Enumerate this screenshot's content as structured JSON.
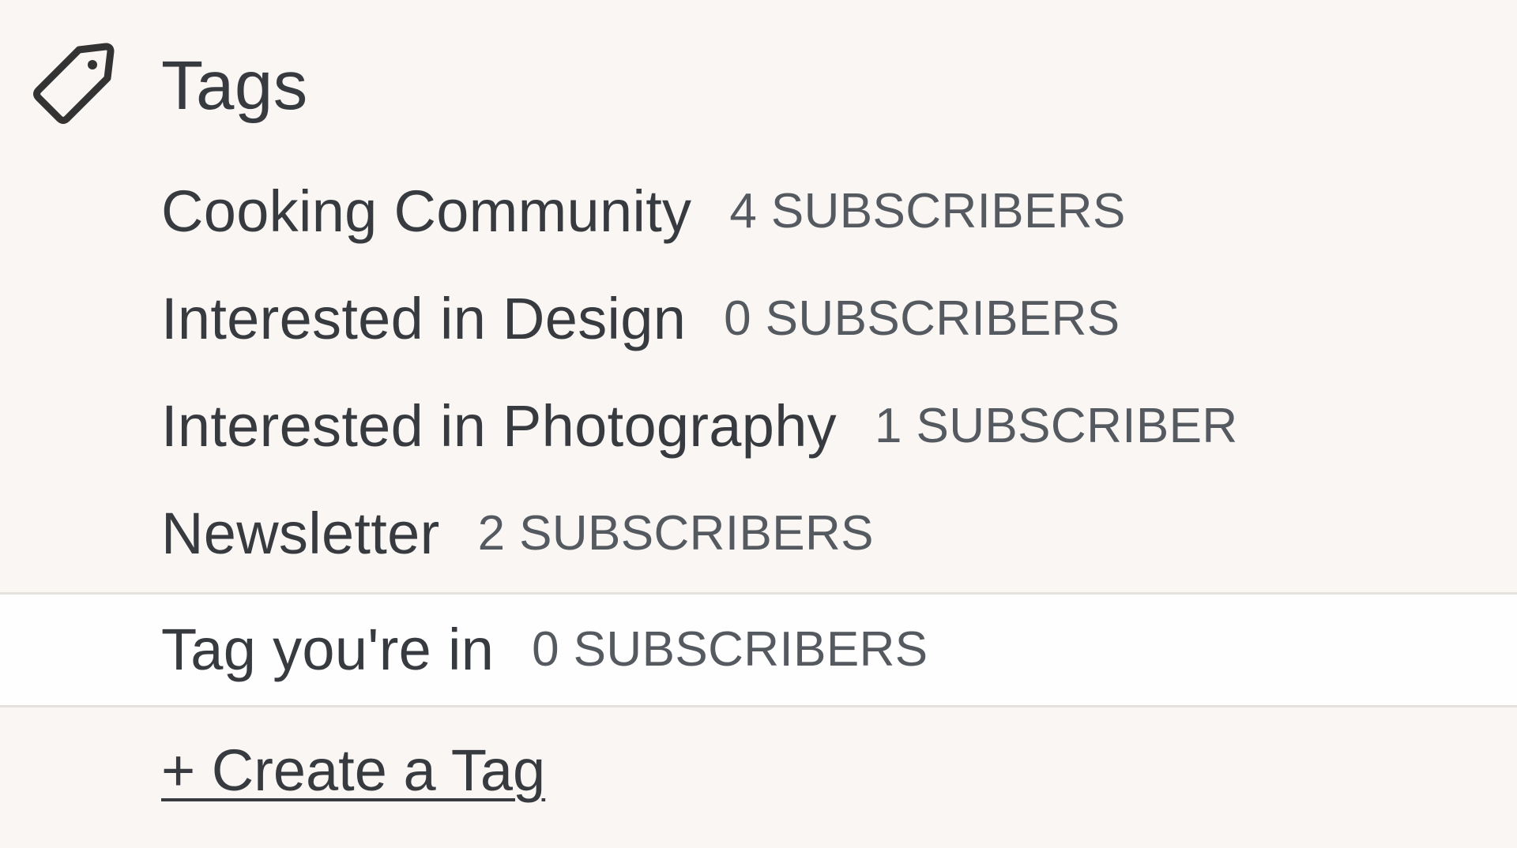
{
  "tags_section": {
    "title": "Tags",
    "icon": "tag-icon",
    "items": [
      {
        "name": "Cooking Community",
        "count": "4 SUBSCRIBERS"
      },
      {
        "name": "Interested in Design",
        "count": "0 SUBSCRIBERS"
      },
      {
        "name": "Interested in Photography",
        "count": "1 SUBSCRIBER"
      },
      {
        "name": "Newsletter",
        "count": "2 SUBSCRIBERS"
      },
      {
        "name": "Tag you're in",
        "count": "0 SUBSCRIBERS",
        "selected": true
      }
    ],
    "create_label": "+ Create a Tag"
  },
  "colors": {
    "background": "#f9f6f3",
    "selected_row_background": "#fffefe",
    "text": "#373b40",
    "muted_text": "#555a60",
    "divider": "#e5e1dc"
  }
}
